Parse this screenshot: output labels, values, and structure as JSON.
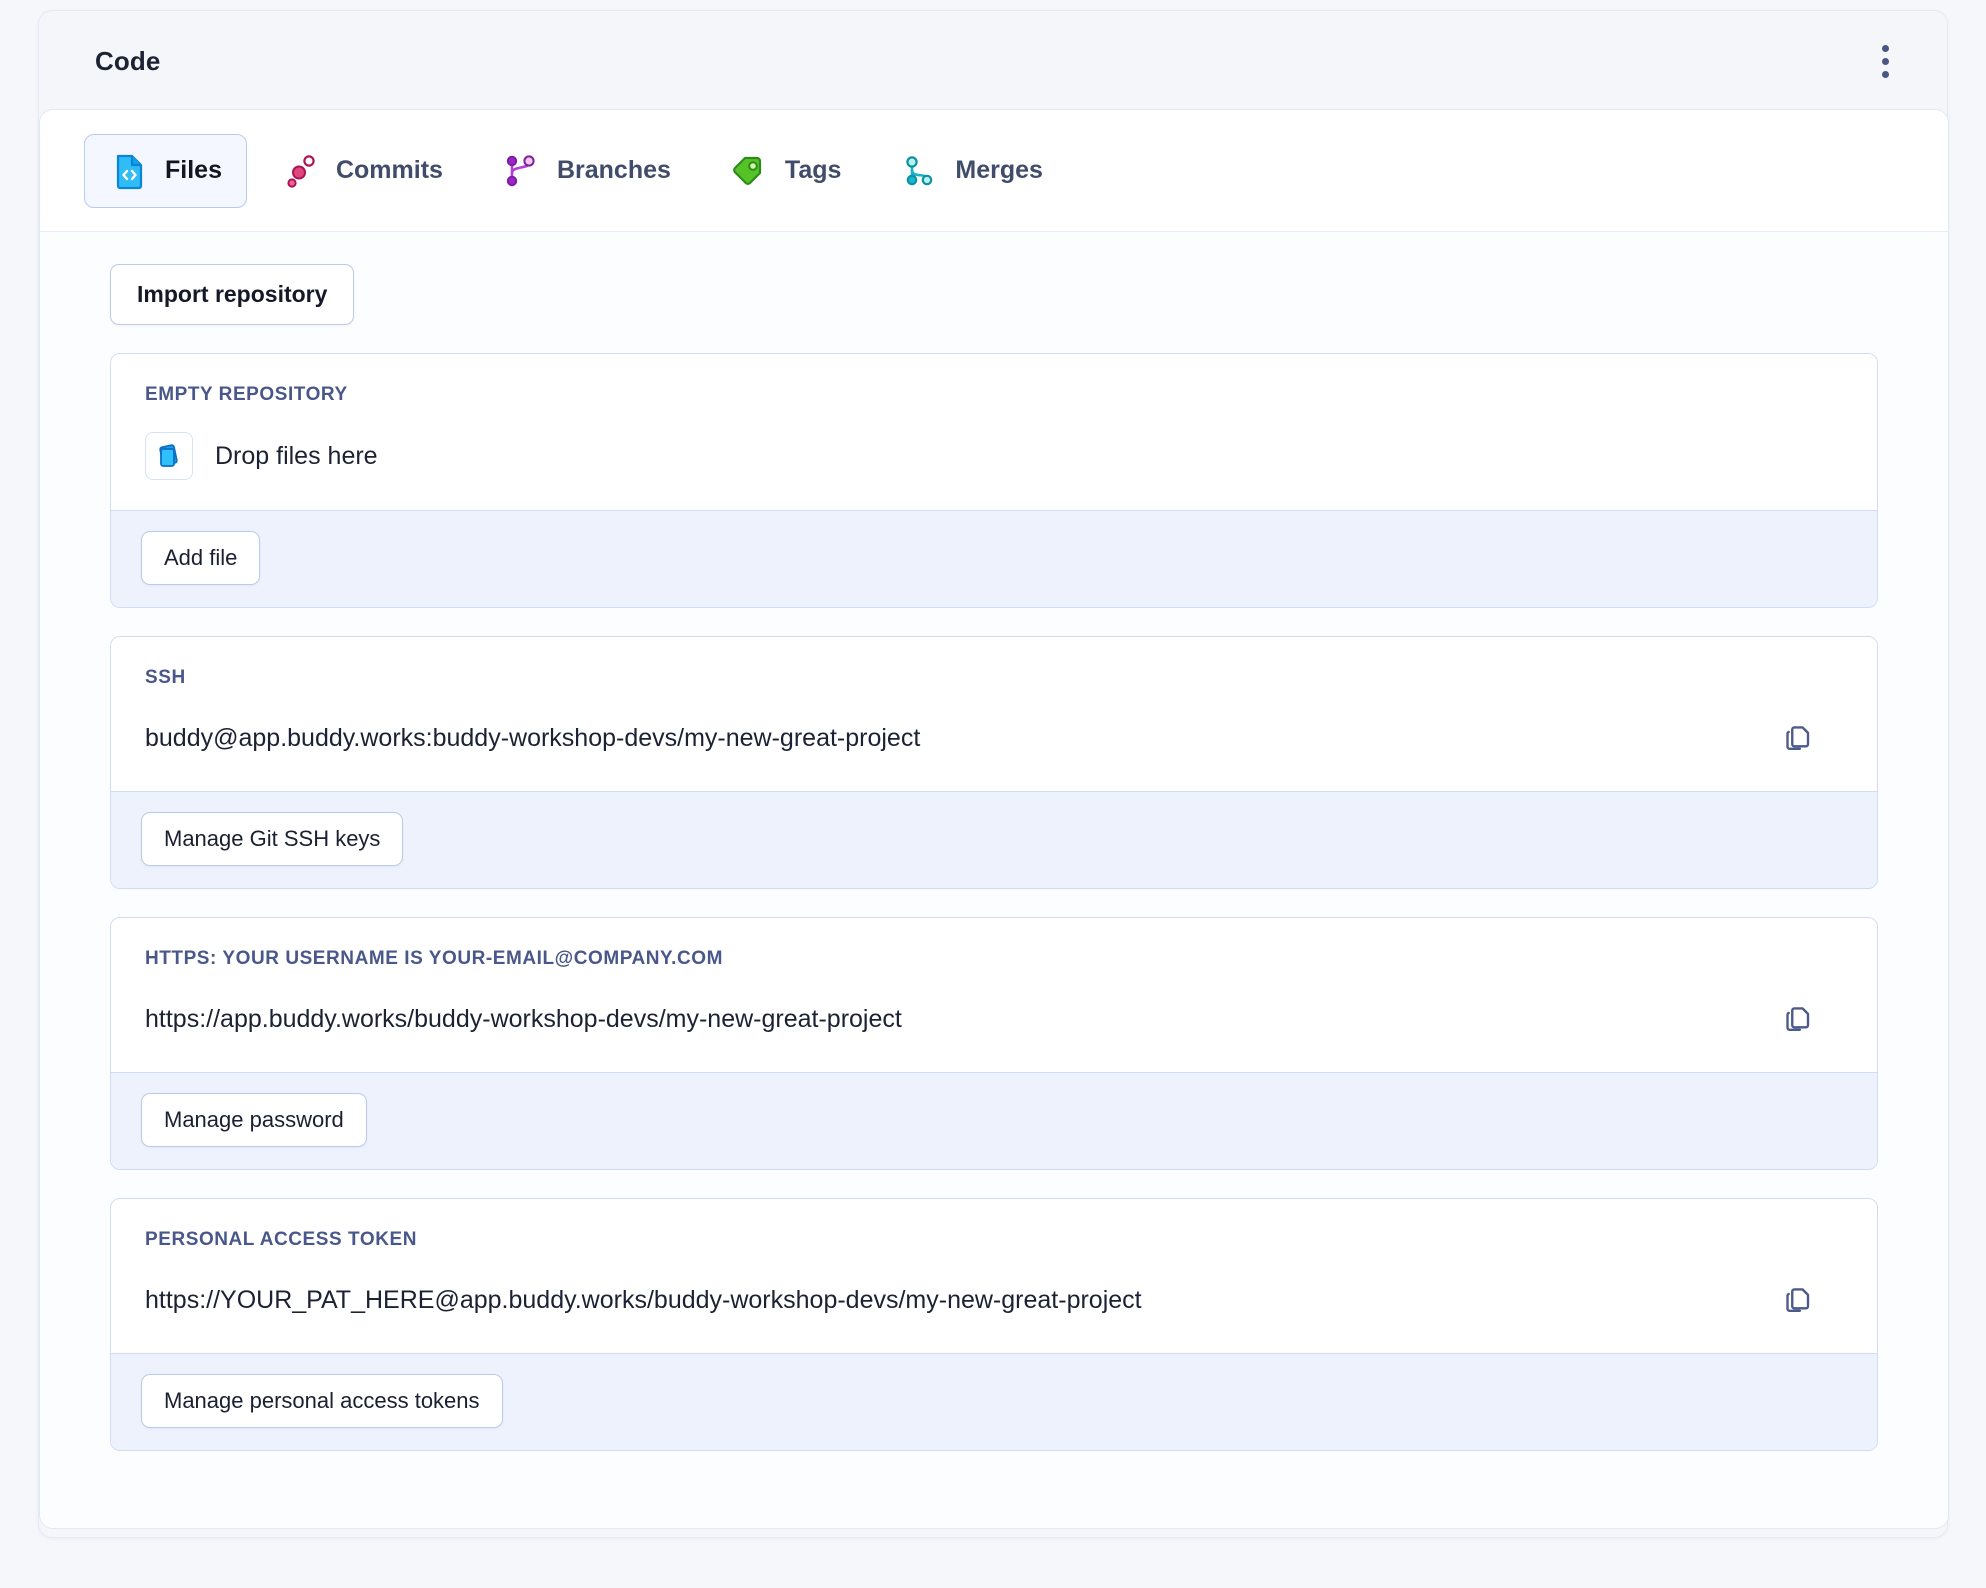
{
  "header": {
    "title": "Code",
    "menu_icon": "kebab-menu-icon"
  },
  "tabs": [
    {
      "label": "Files",
      "icon": "file-code-icon",
      "active": true
    },
    {
      "label": "Commits",
      "icon": "commits-icon",
      "active": false
    },
    {
      "label": "Branches",
      "icon": "branches-icon",
      "active": false
    },
    {
      "label": "Tags",
      "icon": "tag-icon",
      "active": false
    },
    {
      "label": "Merges",
      "icon": "merge-icon",
      "active": false
    }
  ],
  "toolbar": {
    "import_repository_label": "Import repository"
  },
  "sections": [
    {
      "label": "EMPTY REPOSITORY",
      "kind": "drop",
      "drop_text": "Drop files here",
      "drop_icon": "files-stack-icon",
      "button_label": "Add file"
    },
    {
      "label": "SSH",
      "kind": "url",
      "value": "buddy@app.buddy.works:buddy-workshop-devs/my-new-great-project",
      "copy_icon": "copy-icon",
      "button_label": "Manage Git SSH keys"
    },
    {
      "label": "HTTPS: YOUR USERNAME IS YOUR-EMAIL@COMPANY.COM",
      "kind": "url",
      "value": "https://app.buddy.works/buddy-workshop-devs/my-new-great-project",
      "copy_icon": "copy-icon",
      "button_label": "Manage password"
    },
    {
      "label": "PERSONAL ACCESS TOKEN",
      "kind": "url",
      "value": "https://YOUR_PAT_HERE@app.buddy.works/buddy-workshop-devs/my-new-great-project",
      "copy_icon": "copy-icon",
      "button_label": "Manage personal access tokens"
    }
  ],
  "colors": {
    "page_background": "#f5f7fa",
    "panel_header_background": "#f4f6fa",
    "card_background": "#ffffff",
    "footer_background": "#eef2fd",
    "border": "#cfdcf4",
    "label_text": "#49578a",
    "body_text": "#1b2233",
    "active_tab_background": "#f4f7ff",
    "active_tab_border": "#b9c9ef",
    "icon_files": "#29b6f6",
    "icon_commits": "#c2185b",
    "icon_branches": "#9c27b0",
    "icon_tags": "#4caf2f",
    "icon_merges": "#1fb6c9"
  }
}
